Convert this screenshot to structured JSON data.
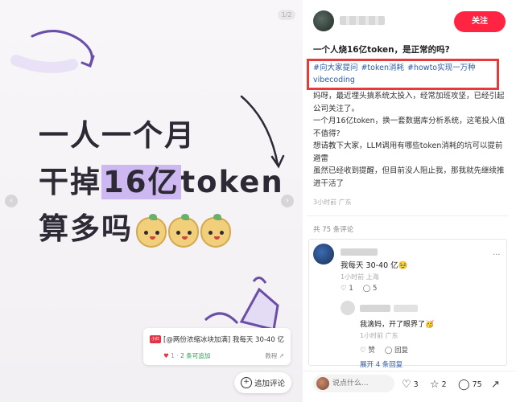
{
  "image": {
    "page_indicator": "1/2",
    "headline_line1": "一人一个月",
    "headline_line2_pre": "干掉",
    "headline_line2_hl": "16亿",
    "headline_line2_post": "token",
    "headline_line3": "算多吗"
  },
  "card": {
    "logo": "小红书",
    "title": "[@两份浓缩冰块加满] 我每天 30-40 亿",
    "likes": "1",
    "addable": "2 条可追加",
    "link": "教程 ↗"
  },
  "add_comment": {
    "label": "追加评论"
  },
  "author": {
    "follow_label": "关注"
  },
  "post": {
    "title": "一个人烧16亿token，是正常的吗?",
    "tags": [
      "#向大家提问",
      "#token消耗",
      "#howto实现一万种vibecoding"
    ],
    "body": [
      "妈呀，最近埋头搞系统太投入，经常加班攻坚，已经引起公司关注了。",
      "一个月16亿token，换一套数据库分析系统，这笔投入值不值得?",
      "想请教下大家，LLM调用有哪些token消耗的坑可以提前避雷",
      "虽然已经收到提醒，但目前没人阻止我，那我就先继续推进干活了"
    ],
    "time": "3小时前  广东"
  },
  "comments": {
    "count_label": "共 75 条评论",
    "c1": {
      "text": "我每天 30-40 亿🥹",
      "time": "1小时前  上海",
      "likes": "1",
      "replies": "5"
    },
    "c2": {
      "text": "我滴妈，开了眼界了🥳",
      "time": "1小时前  广东",
      "like_label": "赞",
      "reply_label": "回复"
    },
    "expand_label": "展开 4 条回复"
  },
  "bottom": {
    "placeholder": "说点什么...",
    "likes": "3",
    "stars": "2",
    "comments": "75"
  },
  "colors": {
    "brand": "#ff2442",
    "tag": "#2b5aa8",
    "highlight_box": "#e83a3a",
    "headline_hl": "#cdb8f2"
  }
}
